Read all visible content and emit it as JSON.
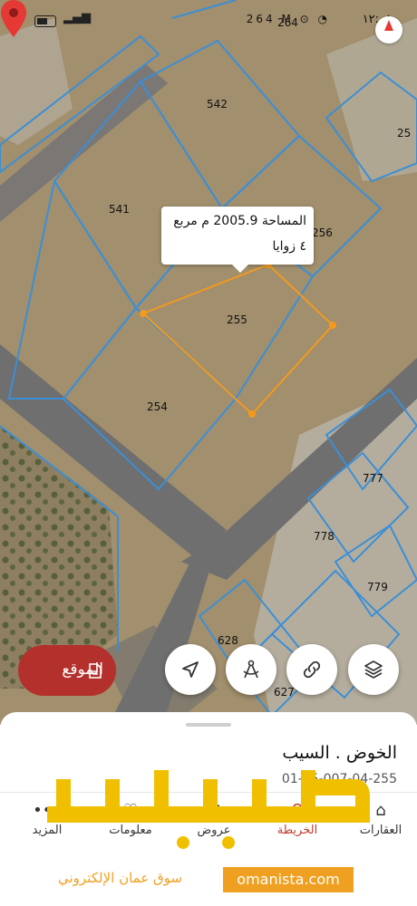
{
  "status_bar": {
    "time": "١٢:٠٨",
    "indicators": "264 M ⊙ ◔"
  },
  "map": {
    "plot_numbers": [
      "264",
      "542",
      "541",
      "256",
      "255",
      "254",
      "777",
      "778",
      "779",
      "628",
      "627",
      "25"
    ],
    "selected_plot": "255"
  },
  "tooltip": {
    "area_text": "المساحة 2005.9 م مربع",
    "corners_text": "٤ زوايا"
  },
  "actions": {
    "location_label": "الموقع",
    "icons": [
      "navigation-arrow-icon",
      "compass-draw-icon",
      "link-icon",
      "layers-icon"
    ]
  },
  "sheet": {
    "place_name": "الخوض . السيب",
    "plot_code": "01-05-007-04-255"
  },
  "nav": {
    "items": [
      {
        "label": "العقارات",
        "icon": "home-icon"
      },
      {
        "label": "الخريطة",
        "icon": "map-pin-icon",
        "active": true
      },
      {
        "label": "عروض",
        "icon": "grid-icon"
      },
      {
        "label": "معلومات",
        "icon": "heart-icon"
      },
      {
        "label": "المزيد",
        "icon": "more-icon"
      }
    ]
  },
  "watermark": {
    "brand": "عمانيستا",
    "domain": "omanista.com",
    "tagline": "سوق عمان الإلكتروني"
  },
  "colors": {
    "accent": "#b3302c",
    "plot_outline": "#3b8fd6",
    "selection": "#f39a1e",
    "watermark": "#f0c000"
  }
}
